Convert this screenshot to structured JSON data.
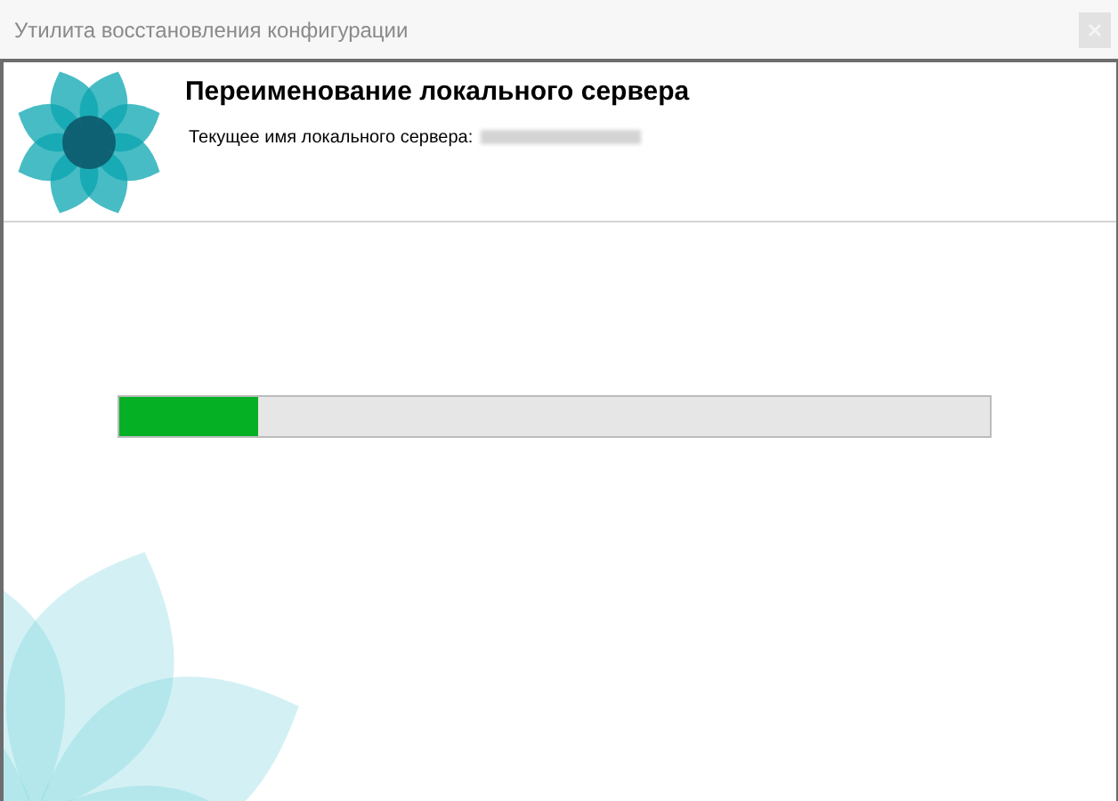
{
  "window": {
    "title": "Утилита восстановления конфигурации"
  },
  "header": {
    "title": "Переименование локального сервера",
    "subtitle": "Текущее имя локального сервера:"
  },
  "progress": {
    "level": 0.16
  }
}
